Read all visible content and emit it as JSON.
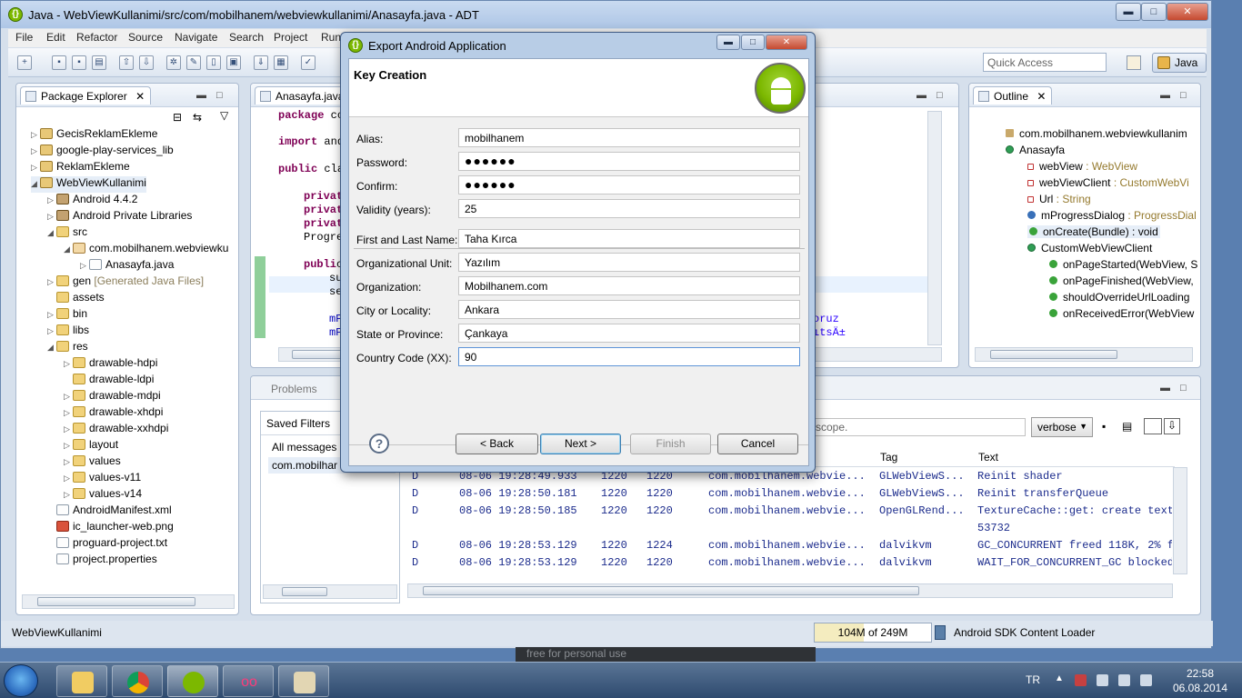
{
  "window": {
    "title": "Java - WebViewKullanimi/src/com/mobilhanem/webviewkullanimi/Anasayfa.java - ADT",
    "min": "▬",
    "max": "□",
    "close": "✕"
  },
  "menu": [
    "File",
    "Edit",
    "Refactor",
    "Source",
    "Navigate",
    "Search",
    "Project",
    "Run"
  ],
  "toolbar": {
    "quick_access": "Quick Access",
    "perspective": "Java"
  },
  "package_explorer": {
    "title": "Package Explorer",
    "items": [
      {
        "label": "GecisReklamEkleme",
        "indent": 0,
        "icon": "project-icon",
        "tw": "▷"
      },
      {
        "label": "google-play-services_lib",
        "indent": 0,
        "icon": "project-icon",
        "tw": "▷"
      },
      {
        "label": "ReklamEkleme",
        "indent": 0,
        "icon": "project-icon",
        "tw": "▷"
      },
      {
        "label": "WebViewKullanimi",
        "indent": 0,
        "icon": "project-icon",
        "tw": "◢"
      },
      {
        "label": "Android 4.4.2",
        "indent": 1,
        "icon": "library-icon",
        "tw": "▷"
      },
      {
        "label": "Android Private Libraries",
        "indent": 1,
        "icon": "library-icon",
        "tw": "▷"
      },
      {
        "label": "src",
        "indent": 1,
        "icon": "folder-icon",
        "tw": "◢"
      },
      {
        "label": "com.mobilhanem.webviewku",
        "indent": 2,
        "icon": "package-icon",
        "tw": "◢"
      },
      {
        "label": "Anasayfa.java",
        "indent": 3,
        "icon": "java-file-icon",
        "tw": "▷"
      },
      {
        "label": "gen",
        "suffix": "[Generated Java Files]",
        "indent": 1,
        "icon": "folder-icon",
        "tw": "▷"
      },
      {
        "label": "assets",
        "indent": 1,
        "icon": "folder-icon",
        "tw": ""
      },
      {
        "label": "bin",
        "indent": 1,
        "icon": "folder-icon",
        "tw": "▷"
      },
      {
        "label": "libs",
        "indent": 1,
        "icon": "folder-icon",
        "tw": "▷"
      },
      {
        "label": "res",
        "indent": 1,
        "icon": "folder-icon",
        "tw": "◢"
      },
      {
        "label": "drawable-hdpi",
        "indent": 2,
        "icon": "folder-icon",
        "tw": "▷"
      },
      {
        "label": "drawable-ldpi",
        "indent": 2,
        "icon": "folder-icon",
        "tw": ""
      },
      {
        "label": "drawable-mdpi",
        "indent": 2,
        "icon": "folder-icon",
        "tw": "▷"
      },
      {
        "label": "drawable-xhdpi",
        "indent": 2,
        "icon": "folder-icon",
        "tw": "▷"
      },
      {
        "label": "drawable-xxhdpi",
        "indent": 2,
        "icon": "folder-icon",
        "tw": "▷"
      },
      {
        "label": "layout",
        "indent": 2,
        "icon": "folder-icon",
        "tw": "▷"
      },
      {
        "label": "values",
        "indent": 2,
        "icon": "folder-icon",
        "tw": "▷"
      },
      {
        "label": "values-v11",
        "indent": 2,
        "icon": "folder-icon",
        "tw": "▷"
      },
      {
        "label": "values-v14",
        "indent": 2,
        "icon": "folder-icon",
        "tw": "▷"
      },
      {
        "label": "AndroidManifest.xml",
        "indent": 1,
        "icon": "xml-file-icon",
        "tw": ""
      },
      {
        "label": "ic_launcher-web.png",
        "indent": 1,
        "icon": "png-file-icon",
        "tw": ""
      },
      {
        "label": "proguard-project.txt",
        "indent": 1,
        "icon": "text-file-icon",
        "tw": ""
      },
      {
        "label": "project.properties",
        "indent": 1,
        "icon": "text-file-icon",
        "tw": ""
      }
    ]
  },
  "editor": {
    "tab": "Anasayfa.java",
    "lines": [
      {
        "kw": "package",
        "rest": " co"
      },
      {
        "kw": "import",
        "rest": " and"
      },
      {
        "kw": "public",
        "rest": " cla"
      },
      {
        "kw": "privat",
        "rest": ""
      },
      {
        "kw": "privat",
        "rest": ""
      },
      {
        "kw": "privat",
        "rest": ""
      },
      {
        "kw": "",
        "rest": "Progre"
      },
      {
        "kw": "publi",
        "rest": "c"
      },
      {
        "kw": "",
        "rest": "su"
      },
      {
        "kw": "",
        "rest": "se"
      },
      {
        "kw": "",
        "rest": "mP"
      },
      {
        "kw": "",
        "rest": "mP"
      }
    ],
    "right_fragments": [
      "oruz",
      "ıtsÄ±"
    ]
  },
  "outline": {
    "title": "Outline",
    "items": [
      {
        "label": "com.mobilhanem.webviewkullanim",
        "type": "",
        "indent": 0,
        "icon": "import-icon"
      },
      {
        "label": "Anasayfa",
        "type": "",
        "indent": 0,
        "icon": "class-icon"
      },
      {
        "label": "webView",
        "type": " : WebView",
        "indent": 1,
        "icon": "private-field-icon"
      },
      {
        "label": "webViewClient",
        "type": " : CustomWebVi",
        "indent": 1,
        "icon": "private-field-icon"
      },
      {
        "label": "Url",
        "type": " : String",
        "indent": 1,
        "icon": "private-field-icon"
      },
      {
        "label": "mProgressDialog",
        "type": " : ProgressDial",
        "indent": 1,
        "icon": "field-icon"
      },
      {
        "label": "onCreate(Bundle) : void",
        "type": "",
        "indent": 1,
        "icon": "method-icon"
      },
      {
        "label": "CustomWebViewClient",
        "type": "",
        "indent": 1,
        "icon": "inner-class-icon"
      },
      {
        "label": "onPageStarted(WebView, S",
        "type": "",
        "indent": 2,
        "icon": "method-icon"
      },
      {
        "label": "onPageFinished(WebView,",
        "type": "",
        "indent": 2,
        "icon": "method-icon"
      },
      {
        "label": "shouldOverrideUrlLoading",
        "type": "",
        "indent": 2,
        "icon": "method-icon"
      },
      {
        "label": "onReceivedError(WebView",
        "type": "",
        "indent": 2,
        "icon": "method-icon"
      }
    ]
  },
  "problems": {
    "tab": "Problems",
    "saved_filters": "Saved Filters",
    "all_messages": "All messages (",
    "filter_item": "com.mobilhar",
    "search_hint": "scope.",
    "level": "verbose",
    "columns": {
      "tag": "Tag",
      "text": "Text"
    },
    "rows": [
      {
        "lvl": "D",
        "time": "08-06 19:28:49.933",
        "pid": "1220",
        "tid": "1220",
        "app": "com.mobilhanem.webvie...",
        "tag": "GLWebViewS...",
        "text": "Reinit shader"
      },
      {
        "lvl": "D",
        "time": "08-06 19:28:50.181",
        "pid": "1220",
        "tid": "1220",
        "app": "com.mobilhanem.webvie...",
        "tag": "GLWebViewS...",
        "text": "Reinit transferQueue"
      },
      {
        "lvl": "D",
        "time": "08-06 19:28:50.185",
        "pid": "1220",
        "tid": "1220",
        "app": "com.mobilhanem.webvie...",
        "tag": "OpenGLRend...",
        "text": "TextureCache::get: create textu"
      },
      {
        "lvl": "",
        "time": "",
        "pid": "",
        "tid": "",
        "app": "",
        "tag": "",
        "text": "53732"
      },
      {
        "lvl": "D",
        "time": "08-06 19:28:53.129",
        "pid": "1220",
        "tid": "1224",
        "app": "com.mobilhanem.webvie...",
        "tag": "dalvikvm",
        "text": "GC_CONCURRENT freed 118K, 2% fr"
      },
      {
        "lvl": "D",
        "time": "08-06 19:28:53.129",
        "pid": "1220",
        "tid": "1220",
        "app": "com.mobilhanem.webvie...",
        "tag": "dalvikvm",
        "text": "WAIT_FOR_CONCURRENT_GC blocked"
      }
    ]
  },
  "status": {
    "left": "WebViewKullanimi",
    "heap": "104M of 249M",
    "heap_used_fraction": 0.42,
    "loader": "Android SDK Content Loader"
  },
  "dialog": {
    "title": "Export Android Application",
    "heading": "Key Creation",
    "fields": {
      "alias": {
        "label": "Alias:",
        "value": "mobilhanem"
      },
      "password": {
        "label": "Password:",
        "value": "●●●●●●"
      },
      "confirm": {
        "label": "Confirm:",
        "value": "●●●●●●"
      },
      "validity": {
        "label": "Validity (years):",
        "value": "25"
      },
      "name": {
        "label": "First and Last Name:",
        "value": "Taha Kırca"
      },
      "unit": {
        "label": "Organizational Unit:",
        "value": "Yazılım"
      },
      "org": {
        "label": "Organization:",
        "value": "Mobilhanem.com"
      },
      "city": {
        "label": "City or Locality:",
        "value": "Ankara"
      },
      "state": {
        "label": "State or Province:",
        "value": "Çankaya"
      },
      "country": {
        "label": "Country Code (XX):",
        "value": "90"
      }
    },
    "buttons": {
      "back": "< Back",
      "next": "Next >",
      "finish": "Finish",
      "cancel": "Cancel"
    },
    "help": "?"
  },
  "taskbar": {
    "lang": "TR",
    "time": "22:58",
    "date": "06.08.2014",
    "bg_window_text": "free for personal use"
  }
}
